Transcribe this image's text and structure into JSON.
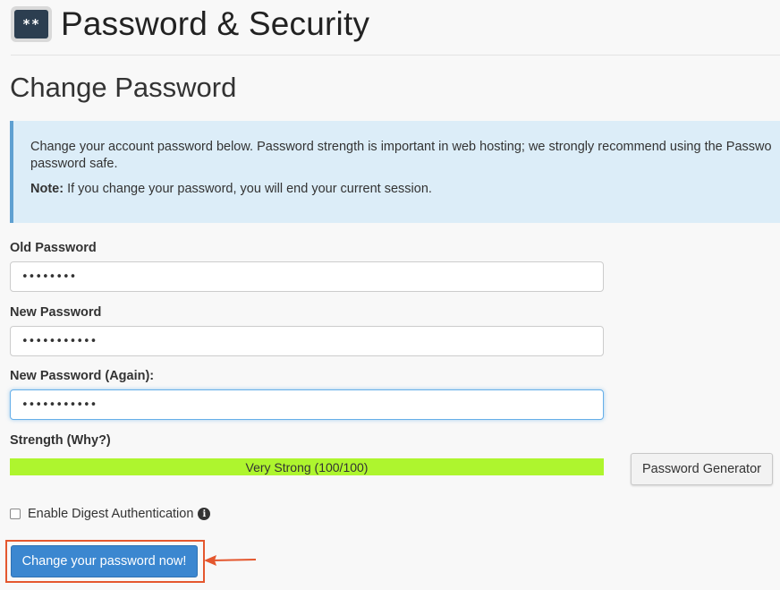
{
  "header": {
    "icon_text": "**",
    "title": "Password & Security"
  },
  "section": {
    "title": "Change Password"
  },
  "info": {
    "line1": "Change your account password below. Password strength is important in web hosting; we strongly recommend using the Passwo",
    "line2": "password safe.",
    "note_label": "Note:",
    "note_text": " If you change your password, you will end your current session."
  },
  "form": {
    "old_password": {
      "label": "Old Password",
      "value": "••••••••"
    },
    "new_password": {
      "label": "New Password",
      "value": "•••••••••••"
    },
    "new_password_again": {
      "label": "New Password (Again):",
      "value": "•••••••••••"
    },
    "strength": {
      "label": "Strength (Why?)",
      "text": "Very Strong (100/100)",
      "percent": 100,
      "color": "#aef52e"
    },
    "generator_button": "Password Generator",
    "digest_auth": {
      "label": "Enable Digest Authentication",
      "checked": false,
      "info_icon": "i"
    },
    "submit_button": "Change your password now!"
  },
  "colors": {
    "accent": "#3b87d0",
    "highlight": "#e4572e",
    "info_bg": "#dcedf8"
  }
}
